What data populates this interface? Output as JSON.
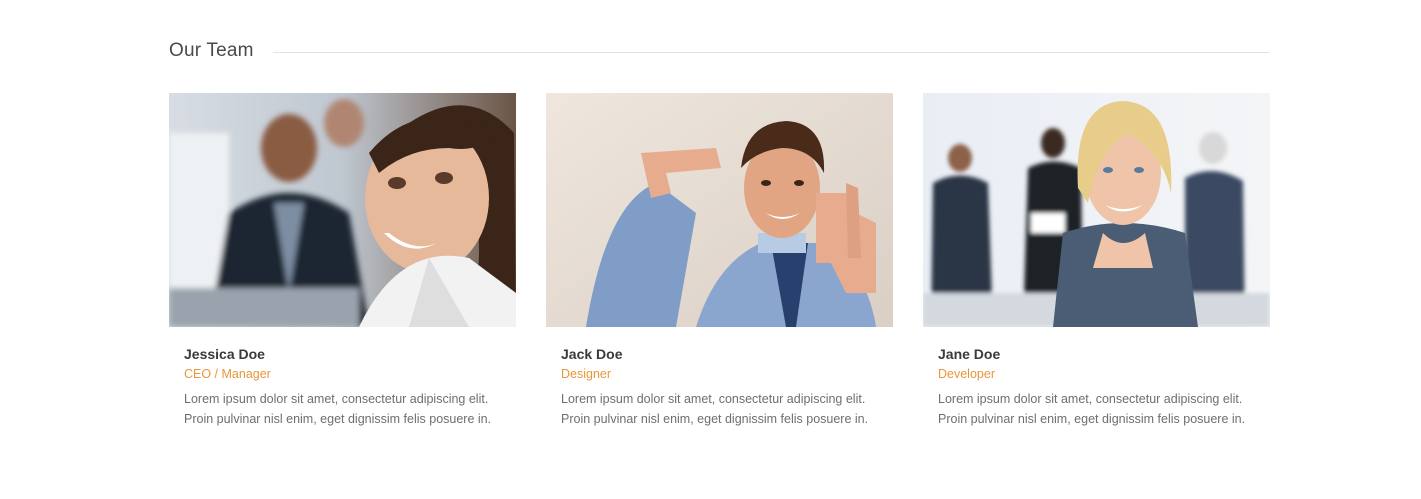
{
  "section": {
    "title": "Our Team"
  },
  "members": [
    {
      "name": "Jessica Doe",
      "role": "CEO / Manager",
      "bio": "Lorem ipsum dolor sit amet, consectetur adipiscing elit. Proin pulvinar nisl enim, eget dignissim felis posuere in.",
      "photo": "smiling-woman-office-photo"
    },
    {
      "name": "Jack Doe",
      "role": "Designer",
      "bio": "Lorem ipsum dolor sit amet, consectetur adipiscing elit. Proin pulvinar nisl enim, eget dignissim felis posuere in.",
      "photo": "man-framing-hands-photo"
    },
    {
      "name": "Jane Doe",
      "role": "Developer",
      "bio": "Lorem ipsum dolor sit amet, consectetur adipiscing elit. Proin pulvinar nisl enim, eget dignissim felis posuere in.",
      "photo": "blonde-woman-business-photo"
    }
  ],
  "colors": {
    "accent": "#e8963a",
    "heading": "#4a4a4a",
    "body_text": "#6e6e6e",
    "rule": "#e3e3e3"
  }
}
